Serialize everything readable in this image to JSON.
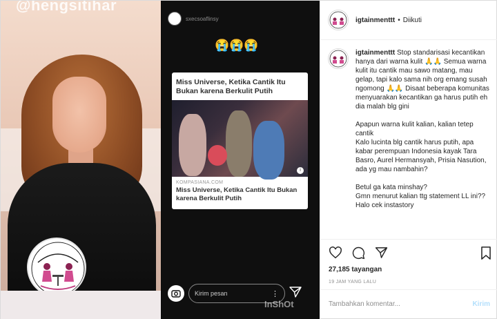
{
  "media": {
    "left": {
      "watermark": "@hengsitihar"
    },
    "story": {
      "username": "sxecsoaflinsy",
      "emoji": "😭😭😭",
      "card_title": "Miss Universe, Ketika Cantik Itu Bukan karena Berkulit Putih",
      "card_domain": "KOMPASIANA.COM",
      "card_title_bottom": "Miss Universe, Ketika Cantik Itu Bukan karena Berkulit Putih",
      "reply_placeholder": "Kirim pesan",
      "inshot": "InShOt"
    }
  },
  "panel": {
    "header": {
      "username": "igtainmenttt",
      "separator": "•",
      "follow_status": "Diikuti"
    },
    "caption": {
      "username": "igtainmenttt",
      "text": "Stop standarisasi kecantikan hanya dari warna kulit 🙏🙏 Semua warna kulit itu cantik mau sawo matang, mau gelap, tapi kalo sama nih org emang susah ngomong 🙏🙏 Disaat beberapa komunitas menyuarakan kecantikan ga harus putih eh dia malah blg gini\n\nApapun warna kulit kalian, kalian tetep cantik\nKalo lucinta blg cantik harus putih, apa kabar perempuan Indonesia kayak Tara Basro, Aurel Hermansyah, Prisia Nasution, ada yg mau nambahin?\n\nBetul ga kata minshay?\nGmn menurut kalian ttg statement LL ini?? Halo cek instastory"
    },
    "actions": {
      "icons": [
        "heart-icon",
        "comment-icon",
        "share-icon",
        "bookmark-icon"
      ],
      "views_count": "27,185",
      "views_label": "tayangan",
      "time_ago": "19 JAM YANG LALU"
    },
    "comment": {
      "placeholder": "Tambahkan komentar...",
      "post_label": "Kirim"
    }
  },
  "colors": {
    "border": "#dbdbdb",
    "text": "#262626",
    "muted": "#8e8e8e",
    "post_button_disabled": "#b2dffc"
  }
}
